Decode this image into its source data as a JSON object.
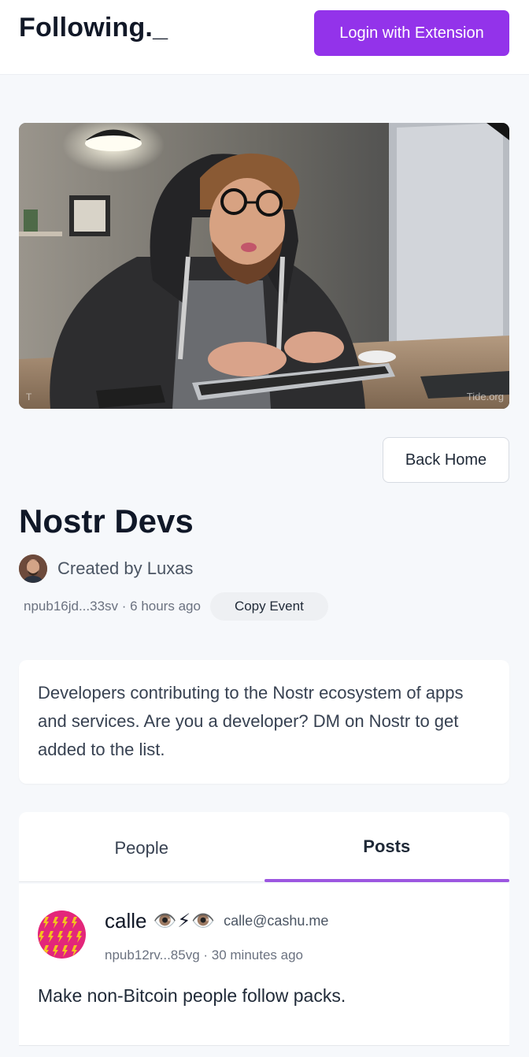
{
  "header": {
    "brand": "Following._",
    "login_label": "Login with Extension"
  },
  "hero": {
    "tag_left": "T",
    "tag_right": "Tide.org"
  },
  "back_home_label": "Back Home",
  "list": {
    "title": "Nostr Devs",
    "created_by": "Created by Luxas",
    "meta": "npub16jd...33sv · 6 hours ago",
    "copy_event_label": "Copy Event",
    "description": "Developers contributing to the Nostr ecosystem of apps and services. Are you a developer? DM on Nostr to get added to the list."
  },
  "tabs": [
    {
      "label": "People",
      "active": false
    },
    {
      "label": "Posts",
      "active": true
    }
  ],
  "post": {
    "name": "calle",
    "emoji": "👁️⚡👁️",
    "nip05": "calle@cashu.me",
    "meta": "npub12rv...85vg · 30 minutes ago",
    "body": "Make non-Bitcoin people follow packs."
  },
  "colors": {
    "accent": "#9333ea",
    "tab_underline": "#9c56e0",
    "background": "#f6f8fb"
  }
}
